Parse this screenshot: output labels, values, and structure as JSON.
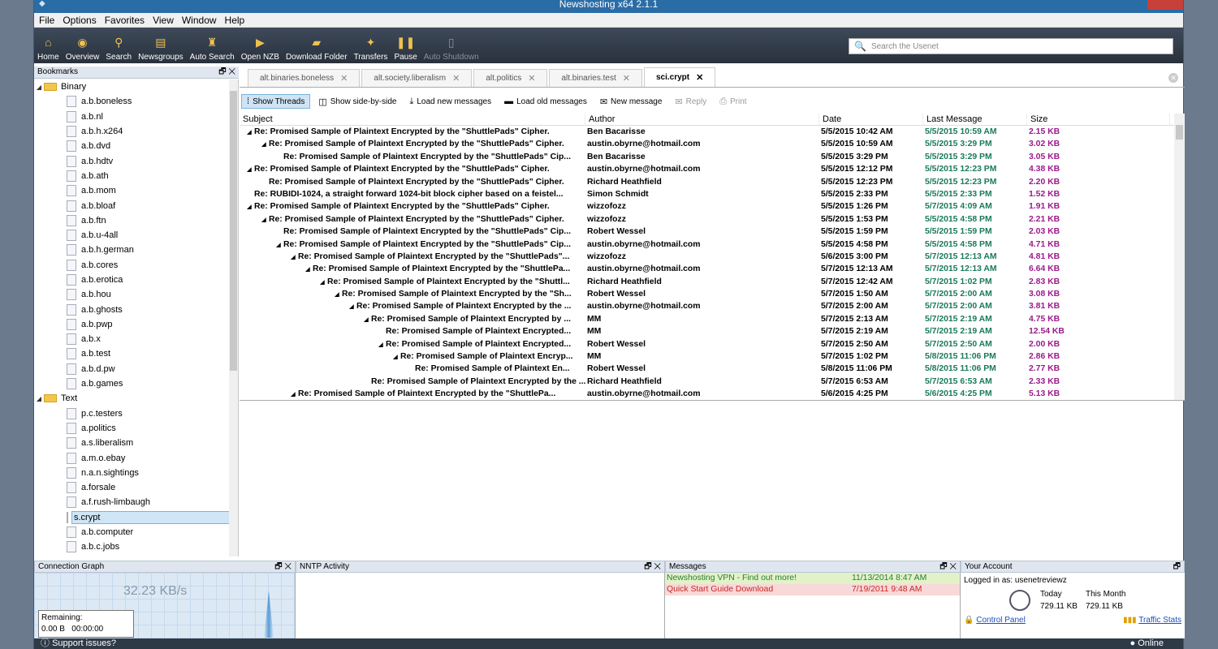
{
  "window": {
    "title": "Newshosting x64 2.1.1"
  },
  "menu": [
    "File",
    "Options",
    "Favorites",
    "View",
    "Window",
    "Help"
  ],
  "toolbar": [
    {
      "label": "Home",
      "icon": "home-icon"
    },
    {
      "label": "Overview",
      "icon": "overview-icon"
    },
    {
      "label": "Search",
      "icon": "search-icon"
    },
    {
      "label": "Newsgroups",
      "icon": "newsgroups-icon"
    },
    {
      "label": "Auto Search",
      "icon": "auto-search-icon"
    },
    {
      "label": "Open NZB",
      "icon": "open-nzb-icon"
    },
    {
      "label": "Download Folder",
      "icon": "download-folder-icon"
    },
    {
      "label": "Transfers",
      "icon": "transfers-icon"
    },
    {
      "label": "Pause",
      "icon": "pause-icon"
    },
    {
      "label": "Auto Shutdown",
      "icon": "auto-shutdown-icon",
      "disabled": true
    }
  ],
  "search": {
    "placeholder": "Search the Usenet"
  },
  "bookmarks": {
    "title": "Bookmarks",
    "groups": [
      {
        "name": "Binary",
        "items": [
          "a.b.boneless",
          "a.b.nl",
          "a.b.h.x264",
          "a.b.dvd",
          "a.b.hdtv",
          "a.b.ath",
          "a.b.mom",
          "a.b.bloaf",
          "a.b.ftn",
          "a.b.u-4all",
          "a.b.h.german",
          "a.b.cores",
          "a.b.erotica",
          "a.b.hou",
          "a.b.ghosts",
          "a.b.pwp",
          "a.b.x",
          "a.b.test",
          "a.b.d.pw",
          "a.b.games"
        ]
      },
      {
        "name": "Text",
        "items": [
          "p.c.testers",
          "a.politics",
          "a.s.liberalism",
          "a.m.o.ebay",
          "n.a.n.sightings",
          "a.forsale",
          "a.f.rush-limbaugh",
          "s.crypt",
          "a.b.computer",
          "a.b.c.jobs"
        ]
      }
    ],
    "selected": "s.crypt"
  },
  "tabs": [
    {
      "label": "alt.binaries.boneless",
      "active": false
    },
    {
      "label": "alt.society.liberalism",
      "active": false
    },
    {
      "label": "alt.politics",
      "active": false
    },
    {
      "label": "alt.binaries.test",
      "active": false
    },
    {
      "label": "sci.crypt",
      "active": true
    }
  ],
  "actions": [
    {
      "label": "Show Threads",
      "icon": "threads-icon",
      "on": true
    },
    {
      "label": "Show side-by-side",
      "icon": "side-by-side-icon"
    },
    {
      "label": "Load new messages",
      "icon": "load-new-icon"
    },
    {
      "label": "Load old messages",
      "icon": "load-old-icon"
    },
    {
      "label": "New message",
      "icon": "new-message-icon"
    },
    {
      "label": "Reply",
      "icon": "reply-icon",
      "disabled": true
    },
    {
      "label": "Print",
      "icon": "print-icon",
      "disabled": true
    }
  ],
  "grid": {
    "columns": [
      "Subject",
      "Author",
      "Date",
      "Last Message",
      "Size"
    ],
    "rows": [
      {
        "indent": 0,
        "tri": true,
        "subject": "Re: Promised Sample of Plaintext Encrypted by the \"ShuttlePads\" Cipher.",
        "author": "Ben Bacarisse",
        "date": "5/5/2015 10:42 AM",
        "last": "5/5/2015 10:59 AM",
        "size": "2.15 KB"
      },
      {
        "indent": 1,
        "tri": true,
        "subject": "Re: Promised Sample of Plaintext Encrypted by the \"ShuttlePads\" Cipher.",
        "author": "austin.obyrne@hotmail.com",
        "date": "5/5/2015 10:59 AM",
        "last": "5/5/2015 3:29 PM",
        "size": "3.02 KB"
      },
      {
        "indent": 2,
        "tri": false,
        "subject": "Re: Promised Sample of Plaintext Encrypted by the \"ShuttlePads\" Cip...",
        "author": "Ben Bacarisse",
        "date": "5/5/2015 3:29 PM",
        "last": "5/5/2015 3:29 PM",
        "size": "3.05 KB"
      },
      {
        "indent": 0,
        "tri": true,
        "subject": "Re: Promised Sample of Plaintext Encrypted by the \"ShuttlePads\" Cipher.",
        "author": "austin.obyrne@hotmail.com",
        "date": "5/5/2015 12:12 PM",
        "last": "5/5/2015 12:23 PM",
        "size": "4.38 KB"
      },
      {
        "indent": 1,
        "tri": false,
        "subject": "Re: Promised Sample of Plaintext Encrypted by the \"ShuttlePads\" Cipher.",
        "author": "Richard Heathfield",
        "date": "5/5/2015 12:23 PM",
        "last": "5/5/2015 12:23 PM",
        "size": "2.20 KB"
      },
      {
        "indent": 0,
        "tri": false,
        "subject": "Re: RUBIDI-1024, a straight forward 1024-bit block cipher based on a feistel...",
        "author": "Simon Schmidt",
        "date": "5/5/2015 2:33 PM",
        "last": "5/5/2015 2:33 PM",
        "size": "1.52 KB"
      },
      {
        "indent": 0,
        "tri": true,
        "subject": "Re: Promised Sample of Plaintext Encrypted by the \"ShuttlePads\" Cipher.",
        "author": "wizzofozz",
        "date": "5/5/2015 1:26 PM",
        "last": "5/7/2015 4:09 AM",
        "size": "1.91 KB"
      },
      {
        "indent": 1,
        "tri": true,
        "subject": "Re: Promised Sample of Plaintext Encrypted by the \"ShuttlePads\" Cipher.",
        "author": "wizzofozz",
        "date": "5/5/2015 1:53 PM",
        "last": "5/5/2015 4:58 PM",
        "size": "2.21 KB"
      },
      {
        "indent": 2,
        "tri": false,
        "subject": "Re: Promised Sample of Plaintext Encrypted by the \"ShuttlePads\" Cip...",
        "author": "Robert Wessel",
        "date": "5/5/2015 1:59 PM",
        "last": "5/5/2015 1:59 PM",
        "size": "2.03 KB"
      },
      {
        "indent": 2,
        "tri": true,
        "subject": "Re: Promised Sample of Plaintext Encrypted by the \"ShuttlePads\" Cip...",
        "author": "austin.obyrne@hotmail.com",
        "date": "5/5/2015 4:58 PM",
        "last": "5/5/2015 4:58 PM",
        "size": "4.71 KB"
      },
      {
        "indent": 3,
        "tri": true,
        "subject": "Re: Promised Sample of Plaintext Encrypted by the \"ShuttlePads\"...",
        "author": "wizzofozz",
        "date": "5/6/2015 3:00 PM",
        "last": "5/7/2015 12:13 AM",
        "size": "4.81 KB"
      },
      {
        "indent": 4,
        "tri": true,
        "subject": "Re: Promised Sample of Plaintext Encrypted by the \"ShuttlePa...",
        "author": "austin.obyrne@hotmail.com",
        "date": "5/7/2015 12:13 AM",
        "last": "5/7/2015 12:13 AM",
        "size": "6.64 KB"
      },
      {
        "indent": 5,
        "tri": true,
        "subject": "Re: Promised Sample of Plaintext Encrypted by the \"Shuttl...",
        "author": "Richard Heathfield",
        "date": "5/7/2015 12:42 AM",
        "last": "5/7/2015 1:02 PM",
        "size": "2.83 KB"
      },
      {
        "indent": 6,
        "tri": true,
        "subject": "Re: Promised Sample of Plaintext Encrypted by the \"Sh...",
        "author": "Robert Wessel",
        "date": "5/7/2015 1:50 AM",
        "last": "5/7/2015 2:00 AM",
        "size": "3.08 KB"
      },
      {
        "indent": 7,
        "tri": true,
        "subject": "Re: Promised Sample of Plaintext Encrypted by the ...",
        "author": "austin.obyrne@hotmail.com",
        "date": "5/7/2015 2:00 AM",
        "last": "5/7/2015 2:00 AM",
        "size": "3.81 KB"
      },
      {
        "indent": 8,
        "tri": true,
        "subject": "Re: Promised Sample of Plaintext Encrypted by ...",
        "author": "MM",
        "date": "5/7/2015 2:13 AM",
        "last": "5/7/2015 2:19 AM",
        "size": "4.75 KB"
      },
      {
        "indent": 9,
        "tri": false,
        "subject": "Re: Promised Sample of Plaintext Encrypted...",
        "author": "MM",
        "date": "5/7/2015 2:19 AM",
        "last": "5/7/2015 2:19 AM",
        "size": "12.54 KB"
      },
      {
        "indent": 9,
        "tri": true,
        "subject": "Re: Promised Sample of Plaintext Encrypted...",
        "author": "Robert Wessel",
        "date": "5/7/2015 2:50 AM",
        "last": "5/7/2015 2:50 AM",
        "size": "2.00 KB"
      },
      {
        "indent": 10,
        "tri": true,
        "subject": "Re: Promised Sample of Plaintext Encryp...",
        "author": "MM",
        "date": "5/7/2015 1:02 PM",
        "last": "5/8/2015 11:06 PM",
        "size": "2.86 KB"
      },
      {
        "indent": 11,
        "tri": false,
        "subject": "Re: Promised Sample of Plaintext En...",
        "author": "Robert Wessel",
        "date": "5/8/2015 11:06 PM",
        "last": "5/8/2015 11:06 PM",
        "size": "2.77 KB"
      },
      {
        "indent": 8,
        "tri": false,
        "subject": "Re: Promised Sample of Plaintext Encrypted by the ...",
        "author": "Richard Heathfield",
        "date": "5/7/2015 6:53 AM",
        "last": "5/7/2015 6:53 AM",
        "size": "2.33 KB"
      },
      {
        "indent": 3,
        "tri": true,
        "subject": "Re: Promised Sample of Plaintext Encrypted by the \"ShuttlePa...",
        "author": "austin.obyrne@hotmail.com",
        "date": "5/6/2015 4:25 PM",
        "last": "5/6/2015 4:25 PM",
        "size": "5.13 KB"
      }
    ]
  },
  "connection": {
    "title": "Connection Graph",
    "speed": "32.23 KB/s",
    "remaining_label": "Remaining:",
    "remaining_value": "0.00 B",
    "remaining_time": "00:00:00"
  },
  "nntp": {
    "title": "NNTP Activity"
  },
  "messages": {
    "title": "Messages",
    "items": [
      {
        "text": "Newshosting VPN - Find out more!",
        "time": "11/13/2014 8:47 AM",
        "bg": "#e2f2c8",
        "color": "#2e7d32"
      },
      {
        "text": "Quick Start Guide Download",
        "time": "7/19/2011 9:48 AM",
        "bg": "#f8d8d8",
        "color": "#c62828"
      }
    ]
  },
  "account": {
    "title": "Your Account",
    "logged_in": "Logged in as: usenetreviewz",
    "today_label": "Today",
    "month_label": "This Month",
    "today_value": "729.11 KB",
    "month_value": "729.11 KB",
    "control_panel": "Control Panel",
    "traffic_stats": "Traffic Stats"
  },
  "status": {
    "support": "Support issues?",
    "online": "Online"
  }
}
